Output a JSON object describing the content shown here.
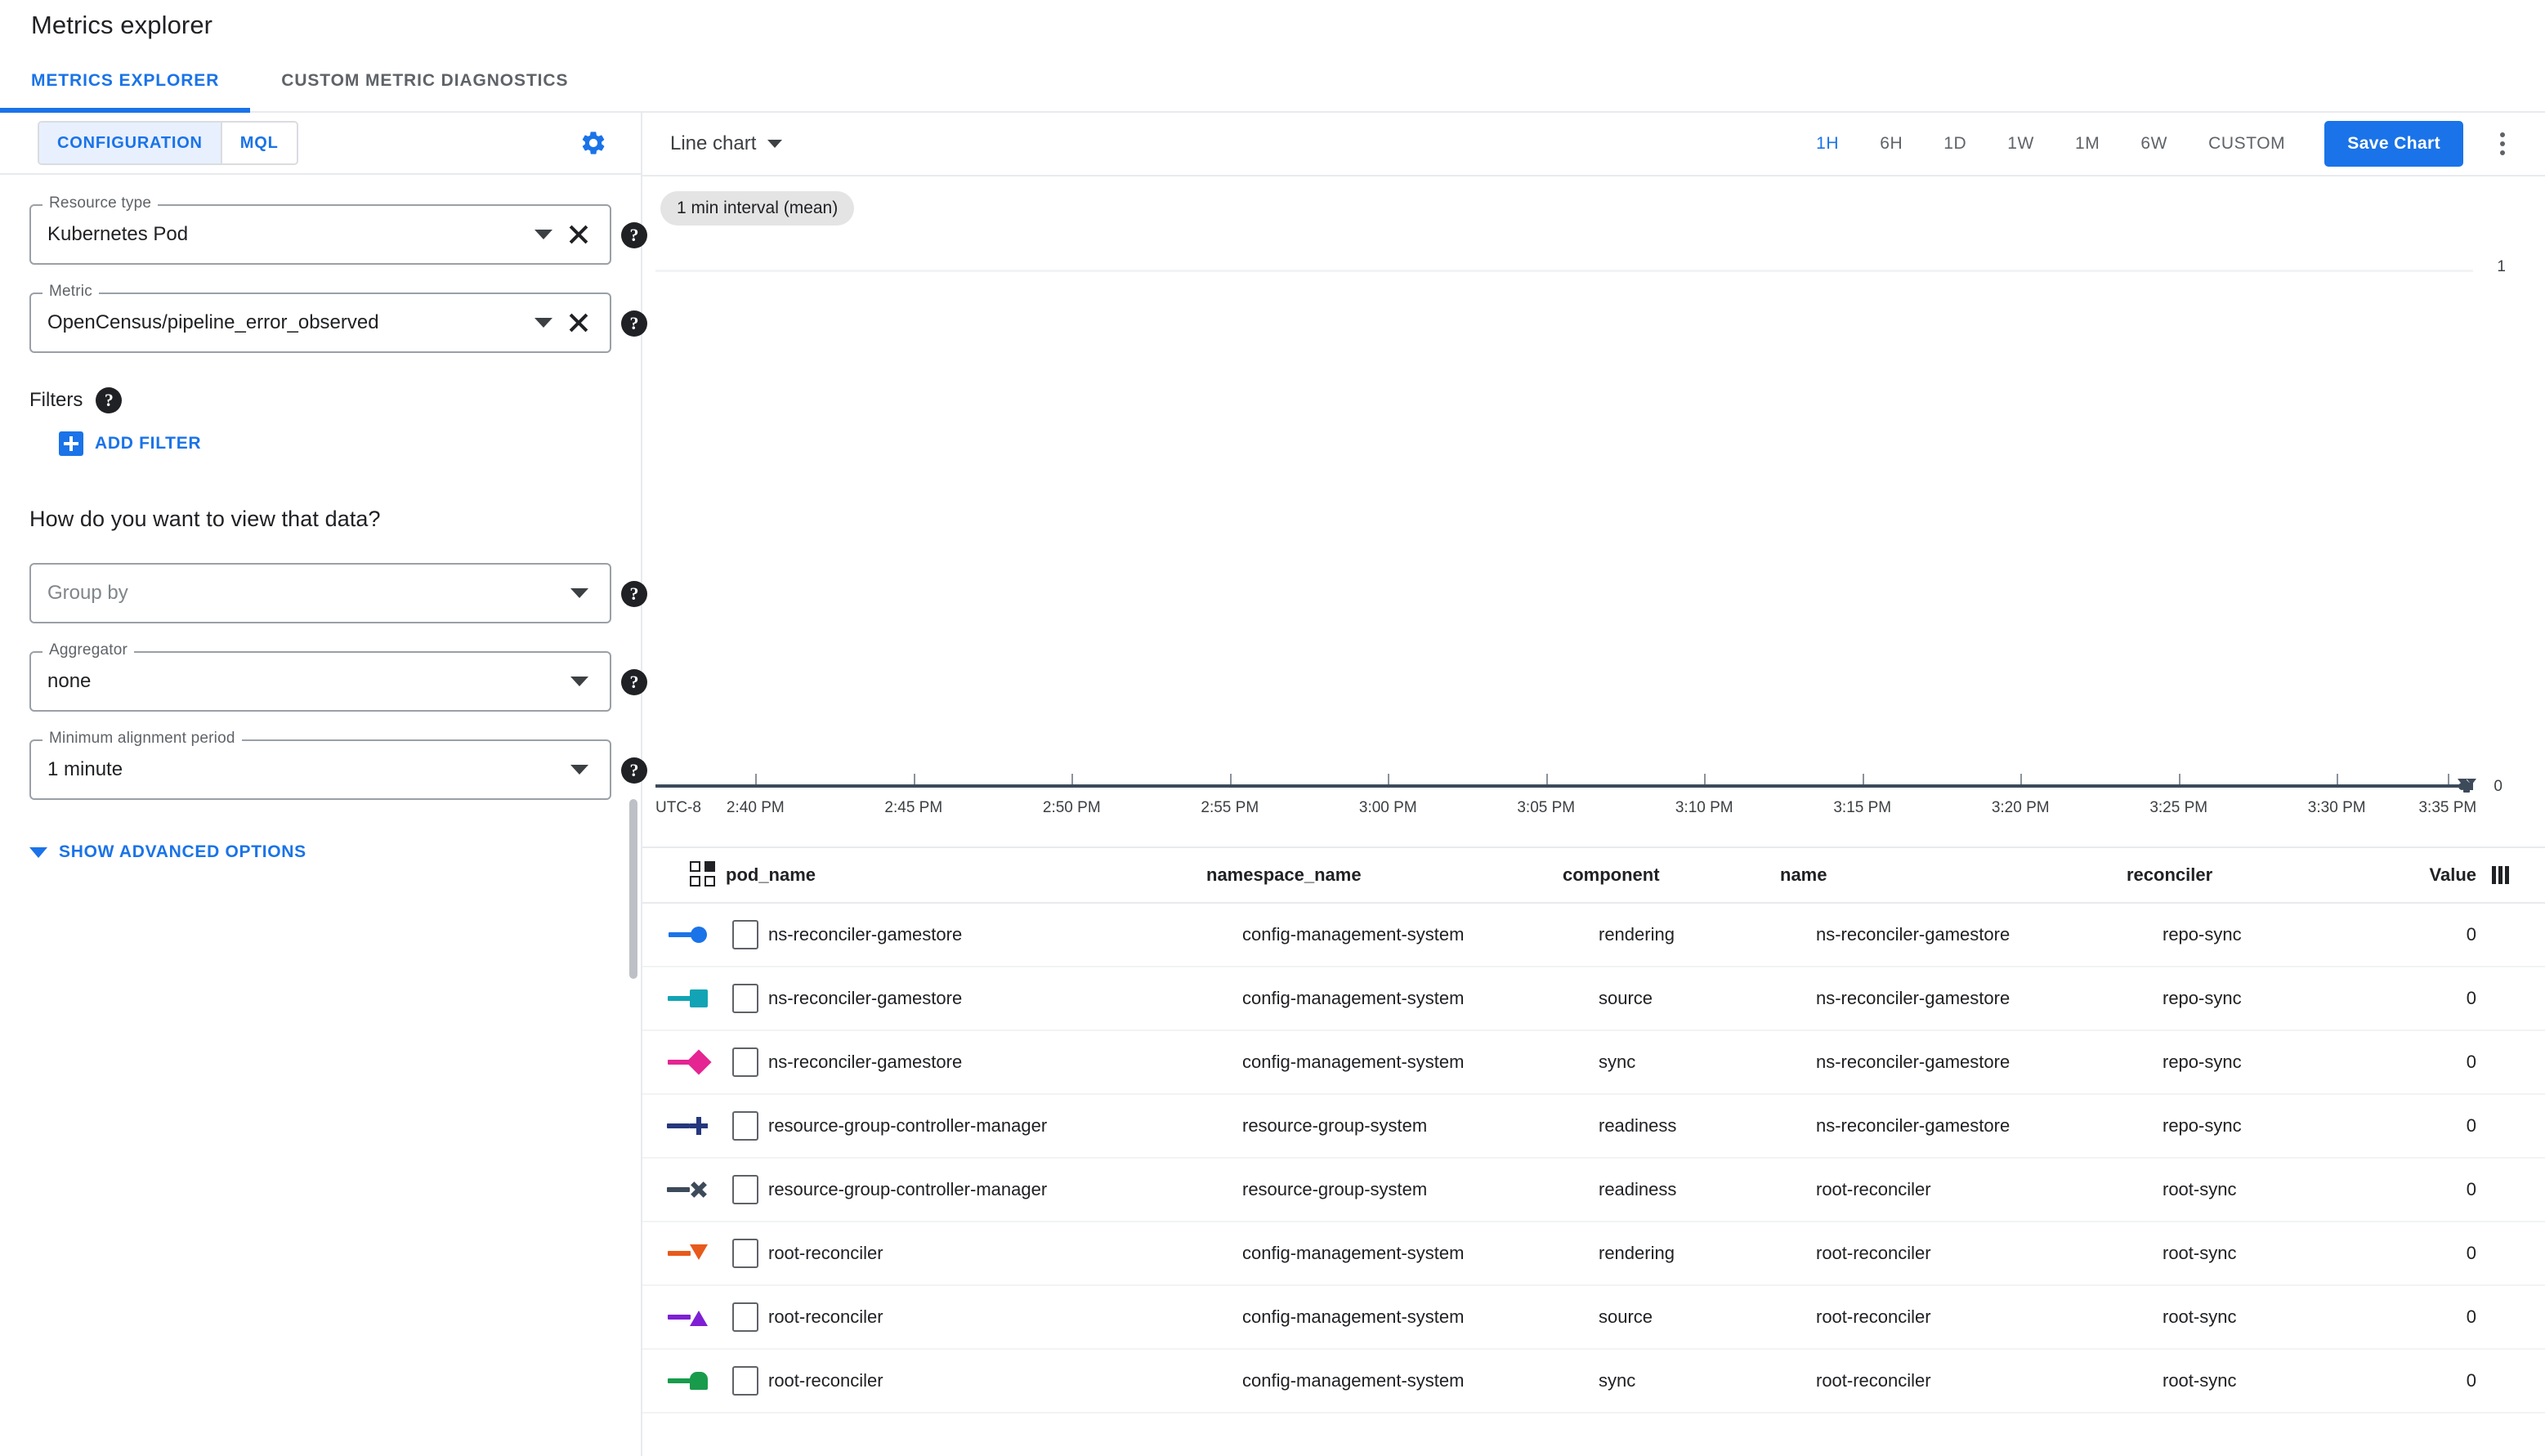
{
  "header": {
    "title": "Metrics explorer"
  },
  "tabs": [
    {
      "label": "METRICS EXPLORER",
      "active": true
    },
    {
      "label": "CUSTOM METRIC DIAGNOSTICS",
      "active": false
    }
  ],
  "config_panel": {
    "segments": [
      {
        "label": "CONFIGURATION",
        "active": true
      },
      {
        "label": "MQL",
        "active": false
      }
    ],
    "gear_icon": "gear-icon",
    "resource_type": {
      "legend": "Resource type",
      "value": "Kubernetes Pod"
    },
    "metric": {
      "legend": "Metric",
      "value": "OpenCensus/pipeline_error_observed"
    },
    "filters": {
      "label": "Filters",
      "add_filter_label": "ADD FILTER"
    },
    "view_question": "How do you want to view that data?",
    "group_by": {
      "legend": "",
      "placeholder": "Group by",
      "value": ""
    },
    "aggregator": {
      "legend": "Aggregator",
      "value": "none"
    },
    "min_alignment_period": {
      "legend": "Minimum alignment period",
      "value": "1 minute"
    },
    "show_advanced_label": "SHOW ADVANCED OPTIONS",
    "help_icon": "help-icon"
  },
  "chart_toolbar": {
    "chart_type": "Line chart",
    "ranges": [
      {
        "label": "1H",
        "active": true
      },
      {
        "label": "6H",
        "active": false
      },
      {
        "label": "1D",
        "active": false
      },
      {
        "label": "1W",
        "active": false
      },
      {
        "label": "1M",
        "active": false
      },
      {
        "label": "6W",
        "active": false
      },
      {
        "label": "CUSTOM",
        "active": false
      }
    ],
    "save_chart_label": "Save Chart",
    "more_options_icon": "kebab-menu-icon",
    "accent_color": "#1a73e8"
  },
  "chart_data": {
    "type": "line",
    "title": "",
    "interval_chip": "1 min interval (mean)",
    "xlabel": "",
    "ylabel": "",
    "timezone_label": "UTC-8",
    "x_tick_labels": [
      "2:40 PM",
      "2:45 PM",
      "2:50 PM",
      "2:55 PM",
      "3:00 PM",
      "3:05 PM",
      "3:10 PM",
      "3:15 PM",
      "3:20 PM",
      "3:25 PM",
      "3:30 PM",
      "3:35 PM"
    ],
    "y_tick_labels": [
      "0",
      "1"
    ],
    "ylim": [
      0,
      1
    ],
    "grid": true,
    "legend_position": "bottom-table",
    "series": [
      {
        "name": "ns-reconciler-gamestore / rendering",
        "color": "#1a73e8",
        "marker": "circle",
        "values": [
          0,
          0,
          0,
          0,
          0,
          0,
          0,
          0,
          0,
          0,
          0,
          0
        ]
      },
      {
        "name": "ns-reconciler-gamestore / source",
        "color": "#12a4b4",
        "marker": "square",
        "values": [
          0,
          0,
          0,
          0,
          0,
          0,
          0,
          0,
          0,
          0,
          0,
          0
        ]
      },
      {
        "name": "ns-reconciler-gamestore / sync",
        "color": "#e52592",
        "marker": "diamond",
        "values": [
          0,
          0,
          0,
          0,
          0,
          0,
          0,
          0,
          0,
          0,
          0,
          0
        ]
      },
      {
        "name": "resource-group-controller-manager / readiness (ns-reconciler-gamestore)",
        "color": "#25377d",
        "marker": "plus",
        "values": [
          0,
          0,
          0,
          0,
          0,
          0,
          0,
          0,
          0,
          0,
          0,
          0
        ]
      },
      {
        "name": "resource-group-controller-manager / readiness (root-reconciler)",
        "color": "#3c4a5a",
        "marker": "x",
        "values": [
          0,
          0,
          0,
          0,
          0,
          0,
          0,
          0,
          0,
          0,
          0,
          0
        ]
      },
      {
        "name": "root-reconciler / rendering",
        "color": "#e8591c",
        "marker": "triangle-down",
        "values": [
          0,
          0,
          0,
          0,
          0,
          0,
          0,
          0,
          0,
          0,
          0,
          0
        ]
      },
      {
        "name": "root-reconciler / source",
        "color": "#7e1fd4",
        "marker": "triangle-up",
        "values": [
          0,
          0,
          0,
          0,
          0,
          0,
          0,
          0,
          0,
          0,
          0,
          0
        ]
      },
      {
        "name": "root-reconciler / sync",
        "color": "#199b4c",
        "marker": "dome",
        "values": [
          0,
          0,
          0,
          0,
          0,
          0,
          0,
          0,
          0,
          0,
          0,
          0
        ]
      }
    ]
  },
  "legend_table": {
    "columns": [
      "pod_name",
      "namespace_name",
      "component",
      "name",
      "reconciler",
      "Value"
    ],
    "select_all_icon": "select-all-icon",
    "columns_icon": "column-settings-icon",
    "rows": [
      {
        "color": "#1a73e8",
        "marker": "circle",
        "pod_name": "ns-reconciler-gamestore",
        "namespace_name": "config-management-system",
        "component": "rendering",
        "name": "ns-reconciler-gamestore",
        "reconciler": "repo-sync",
        "value": "0"
      },
      {
        "color": "#12a4b4",
        "marker": "square",
        "pod_name": "ns-reconciler-gamestore",
        "namespace_name": "config-management-system",
        "component": "source",
        "name": "ns-reconciler-gamestore",
        "reconciler": "repo-sync",
        "value": "0"
      },
      {
        "color": "#e52592",
        "marker": "diamond",
        "pod_name": "ns-reconciler-gamestore",
        "namespace_name": "config-management-system",
        "component": "sync",
        "name": "ns-reconciler-gamestore",
        "reconciler": "repo-sync",
        "value": "0"
      },
      {
        "color": "#25377d",
        "marker": "plus",
        "pod_name": "resource-group-controller-manager",
        "namespace_name": "resource-group-system",
        "component": "readiness",
        "name": "ns-reconciler-gamestore",
        "reconciler": "repo-sync",
        "value": "0"
      },
      {
        "color": "#3c4a5a",
        "marker": "x",
        "pod_name": "resource-group-controller-manager",
        "namespace_name": "resource-group-system",
        "component": "readiness",
        "name": "root-reconciler",
        "reconciler": "root-sync",
        "value": "0"
      },
      {
        "color": "#e8591c",
        "marker": "triangle-down",
        "pod_name": "root-reconciler",
        "namespace_name": "config-management-system",
        "component": "rendering",
        "name": "root-reconciler",
        "reconciler": "root-sync",
        "value": "0"
      },
      {
        "color": "#7e1fd4",
        "marker": "triangle-up",
        "pod_name": "root-reconciler",
        "namespace_name": "config-management-system",
        "component": "source",
        "name": "root-reconciler",
        "reconciler": "root-sync",
        "value": "0"
      },
      {
        "color": "#199b4c",
        "marker": "dome",
        "pod_name": "root-reconciler",
        "namespace_name": "config-management-system",
        "component": "sync",
        "name": "root-reconciler",
        "reconciler": "root-sync",
        "value": "0"
      }
    ]
  }
}
